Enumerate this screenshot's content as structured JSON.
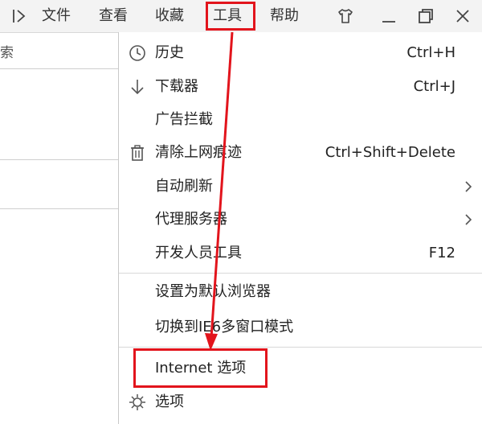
{
  "topbar": {
    "menus": [
      "文件",
      "查看",
      "收藏",
      "工具",
      "帮助"
    ],
    "window_controls": [
      "shirt-icon",
      "minimize-icon",
      "maximize-icon",
      "close-icon"
    ]
  },
  "left": {
    "partial_text": "索"
  },
  "menu": {
    "history": {
      "label": "历史",
      "shortcut": "Ctrl+H",
      "icon": "clock-icon"
    },
    "downloads": {
      "label": "下载器",
      "shortcut": "Ctrl+J",
      "icon": "download-arrow-icon"
    },
    "adblock": {
      "label": "广告拦截"
    },
    "clear": {
      "label": "清除上网痕迹",
      "shortcut": "Ctrl+Shift+Delete",
      "icon": "trash-icon"
    },
    "autorefresh": {
      "label": "自动刷新"
    },
    "proxy": {
      "label": "代理服务器"
    },
    "devtools": {
      "label": "开发人员工具",
      "shortcut": "F12"
    },
    "default_browser": {
      "label": "设置为默认浏览器"
    },
    "ie6": {
      "label": "切换到IE6多窗口模式"
    },
    "internet_options": {
      "label": "Internet 选项"
    },
    "options": {
      "label": "选项",
      "icon": "gear-icon"
    }
  },
  "colors": {
    "annotation": "#e2141c",
    "menubar": "#f3f3f3"
  }
}
